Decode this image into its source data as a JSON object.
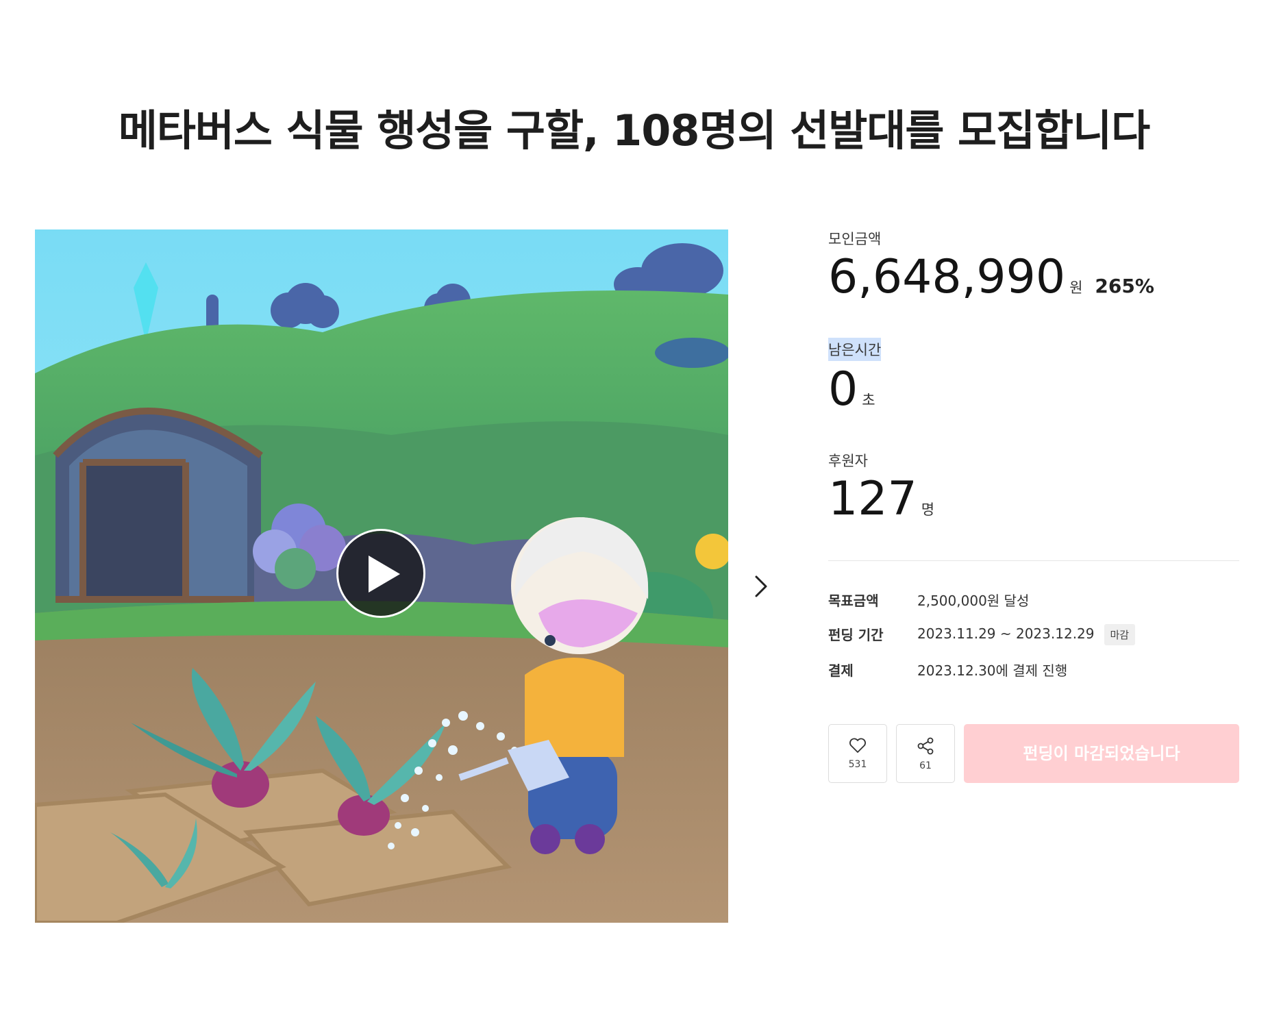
{
  "page_title": "메타버스 식물 행성을 구할, 108명의 선발대를 모집합니다",
  "funding": {
    "amount_label": "모인금액",
    "amount": "6,648,990",
    "amount_unit": "원",
    "percent": "265%",
    "time_label": "남은시간",
    "time_value": "0",
    "time_unit": "초",
    "backers_label": "후원자",
    "backers_value": "127",
    "backers_unit": "명"
  },
  "details": {
    "goal_label": "목표금액",
    "goal_value": "2,500,000원 달성",
    "period_label": "펀딩 기간",
    "period_value": "2023.11.29 ~ 2023.12.29",
    "period_badge": "마감",
    "payment_label": "결제",
    "payment_value": "2023.12.30에 결제 진행"
  },
  "actions": {
    "like_count": "531",
    "share_count": "61",
    "cta_label": "펀딩이 마감되었습니다"
  },
  "icons": {
    "play": "play-icon",
    "next": "chevron-right-icon",
    "like": "heart-icon",
    "share": "share-icon"
  },
  "colors": {
    "cta_bg": "#ffcfd2",
    "highlight": "#cfe1fb"
  }
}
